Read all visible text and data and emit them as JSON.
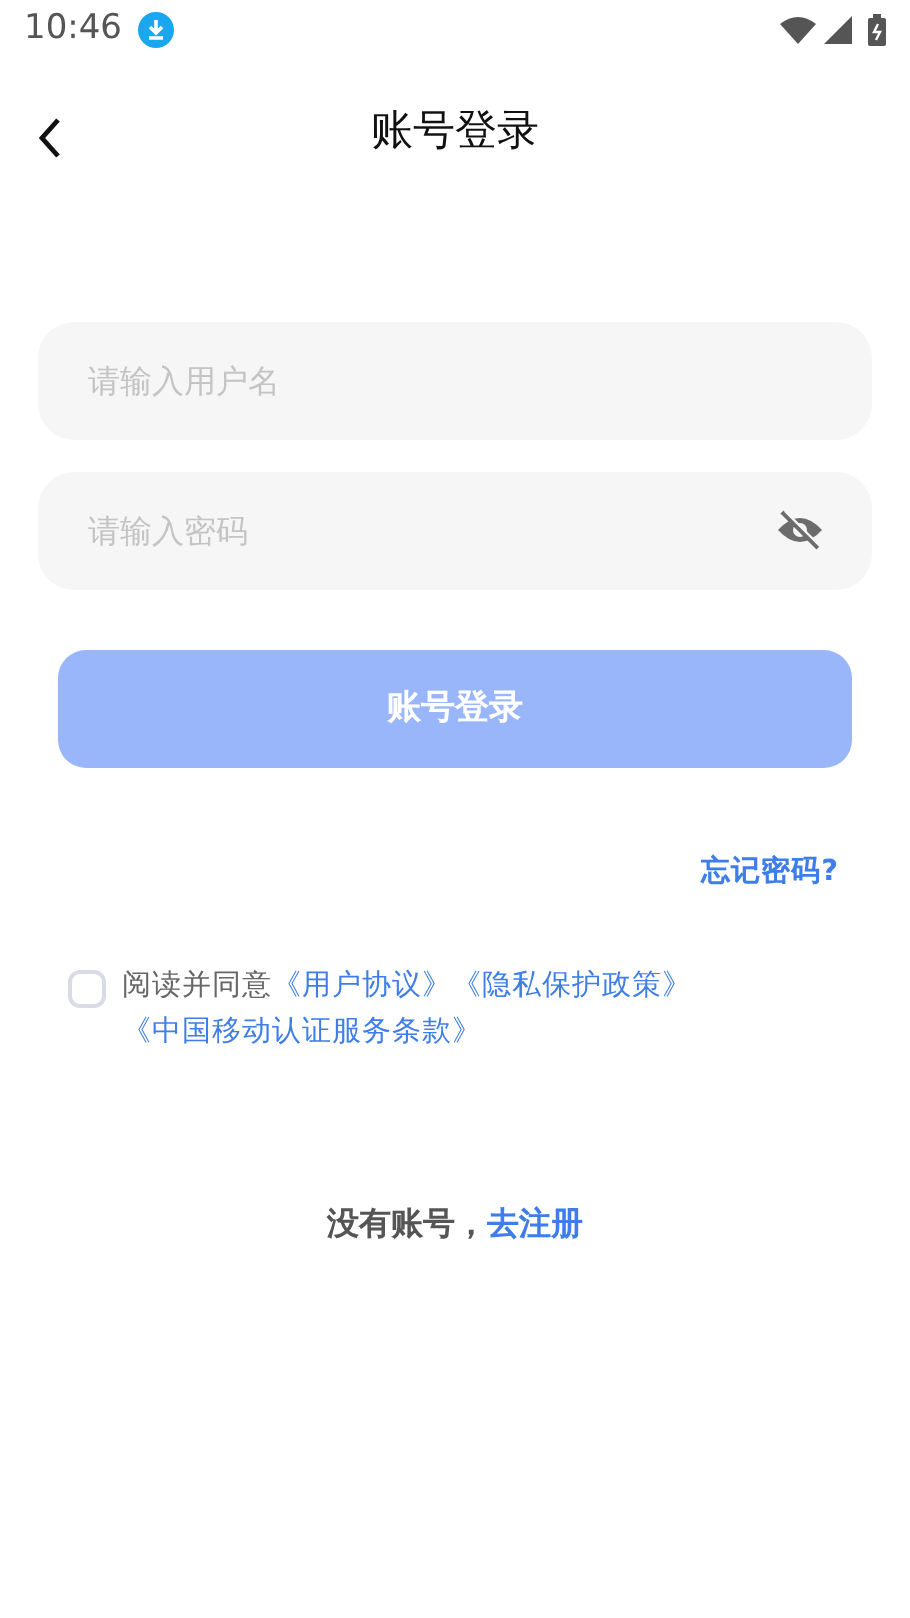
{
  "status_bar": {
    "time": "10:46"
  },
  "header": {
    "title": "账号登录"
  },
  "username_field": {
    "placeholder": "请输入用户名"
  },
  "password_field": {
    "placeholder": "请输入密码",
    "visible": false
  },
  "login_button": {
    "label": "账号登录",
    "disabled": true
  },
  "forgot_link": "忘记密码?",
  "agreement": {
    "checked": false,
    "text": "阅读并同意",
    "links": [
      "《用户协议》",
      "《隐私保护政策》",
      "《中国移动认证服务条款》"
    ]
  },
  "register": {
    "prompt": "没有账号，",
    "link": "去注册"
  }
}
